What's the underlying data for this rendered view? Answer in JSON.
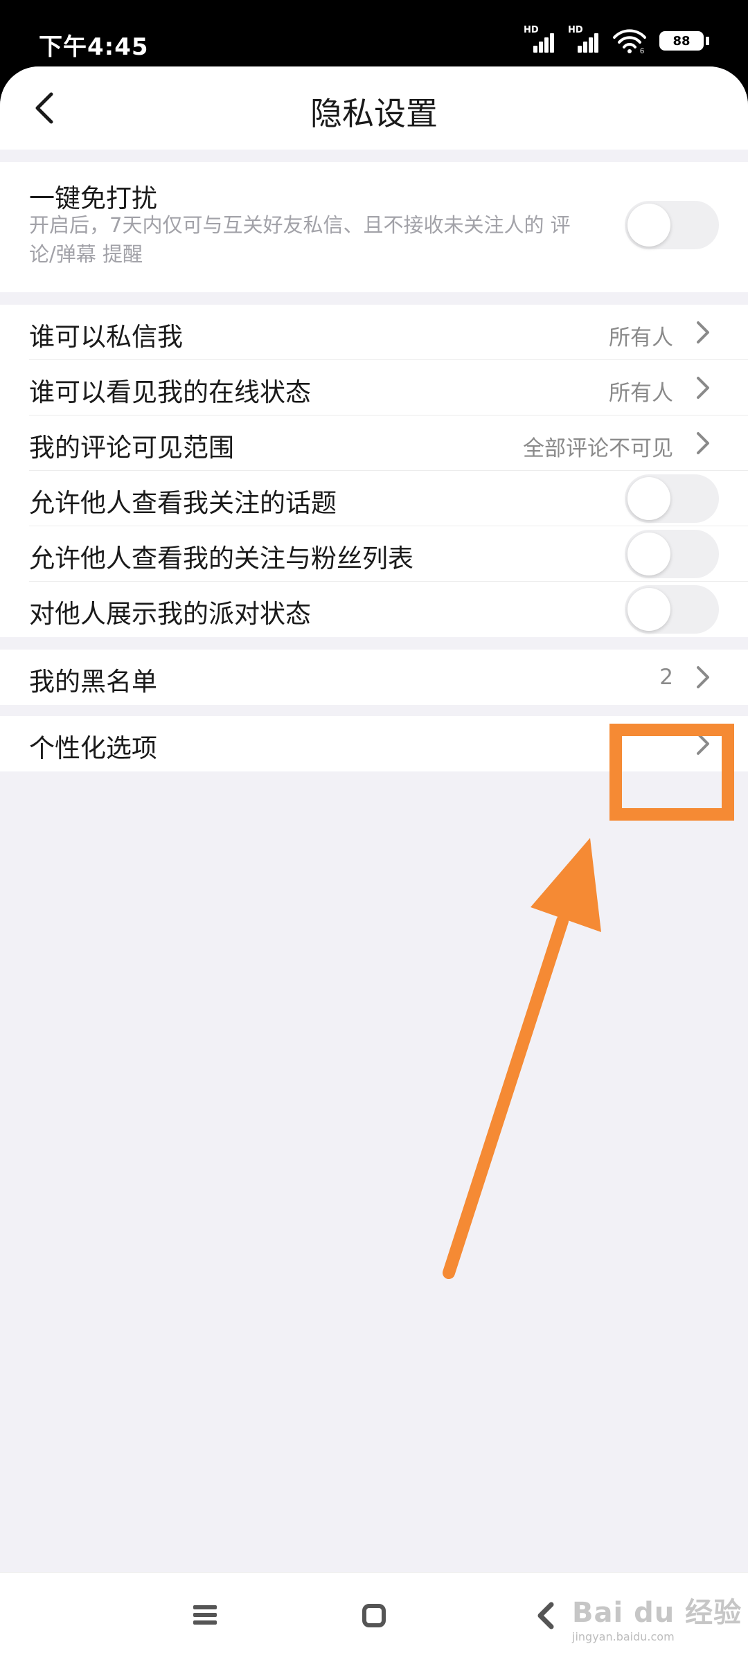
{
  "status_bar": {
    "time": "下午4:45",
    "signal1_label": "HD",
    "signal2_label": "HD",
    "wifi_label": "6",
    "battery": "88",
    "icons": [
      "signal-icon",
      "signal-icon",
      "wifi-icon",
      "battery-icon"
    ]
  },
  "nav": {
    "back_icon": "chevron-left-icon",
    "title": "隐私设置"
  },
  "dnd": {
    "label": "一键免打扰",
    "description": "开启后，7天内仅可与互关好友私信、且不接收未关注人的 评论/弹幕 提醒",
    "enabled": false
  },
  "settings": {
    "who_can_message": {
      "label": "谁可以私信我",
      "value": "所有人"
    },
    "who_can_see_online": {
      "label": "谁可以看见我的在线状态",
      "value": "所有人"
    },
    "comment_visibility": {
      "label": "我的评论可见范围",
      "value": "全部评论不可见"
    },
    "allow_view_topics": {
      "label": "允许他人查看我关注的话题",
      "enabled": false
    },
    "allow_view_follow_list": {
      "label": "允许他人查看我的关注与粉丝列表",
      "enabled": false
    },
    "show_party_status": {
      "label": "对他人展示我的派对状态",
      "enabled": false
    }
  },
  "blacklist": {
    "label": "我的黑名单",
    "count": "2"
  },
  "personalization": {
    "label": "个性化选项"
  },
  "annotation": {
    "color": "#f58a34"
  },
  "bottom_nav": {
    "icons": [
      "menu-icon",
      "home-icon",
      "back-icon"
    ]
  },
  "watermark": {
    "brand": "Bai du 经验",
    "url": "jingyan.baidu.com"
  }
}
